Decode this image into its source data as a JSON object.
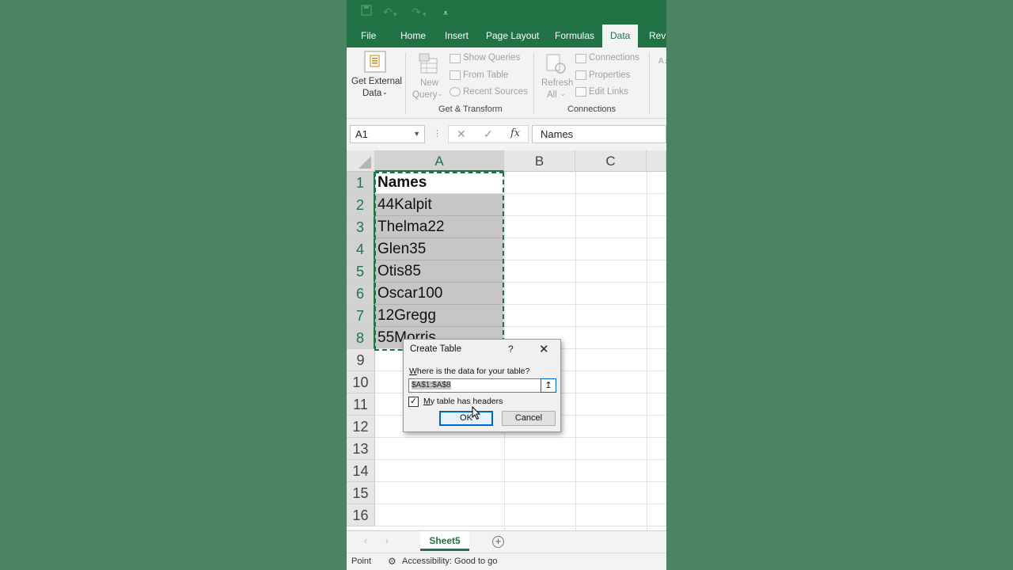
{
  "quick_access": {
    "save_icon": "save-icon",
    "undo_icon": "undo-icon",
    "redo_icon": "redo-icon",
    "customize_icon": "customize-qat-icon"
  },
  "ribbon_tabs": [
    "File",
    "Home",
    "Insert",
    "Page Layout",
    "Formulas",
    "Data",
    "Revi"
  ],
  "active_tab": "Data",
  "ribbon": {
    "get_external_data": {
      "line1": "Get External",
      "line2": "Data"
    },
    "get_transform": {
      "new_query": {
        "line1": "New",
        "line2": "Query"
      },
      "show_queries": "Show Queries",
      "from_table": "From Table",
      "recent_sources": "Recent Sources",
      "label": "Get & Transform"
    },
    "connections": {
      "refresh": {
        "line1": "Refresh",
        "line2": "All"
      },
      "connections": "Connections",
      "properties": "Properties",
      "edit_links": "Edit Links",
      "label": "Connections"
    }
  },
  "formula_bar": {
    "name_box": "A1",
    "cancel": "✕",
    "enter": "✓",
    "fx": "fx",
    "content": "Names"
  },
  "grid": {
    "columns": [
      "A",
      "B",
      "C"
    ],
    "rows": [
      "1",
      "2",
      "3",
      "4",
      "5",
      "6",
      "7",
      "8",
      "9",
      "10",
      "11",
      "12",
      "13",
      "14",
      "15",
      "16"
    ],
    "column_a": [
      "Names",
      "44Kalpit",
      "Thelma22",
      "Glen35",
      "Otis85",
      "Oscar100",
      "12Gregg",
      "55Morris"
    ]
  },
  "dialog": {
    "title": "Create Table",
    "help": "?",
    "close": "✕",
    "question_prefix": "W",
    "question_rest": "here is the data for your table?",
    "range": "$A$1:$A$8",
    "collapse": "↥",
    "checkbox_checked": true,
    "checkbox_mark": "✓",
    "checkbox_label_prefix": "M",
    "checkbox_label_rest": "y table has headers",
    "ok": "OK",
    "cancel": "Cancel"
  },
  "sheet_tabs": {
    "prev": "‹",
    "next": "›",
    "active": "Sheet5",
    "add": "+"
  },
  "status_bar": {
    "mode": "Point",
    "accessibility": "Accessibility: Good to go"
  },
  "colors": {
    "excel_green": "#217346",
    "background": "#4a8462",
    "selection_fill": "#c6c6c6"
  }
}
